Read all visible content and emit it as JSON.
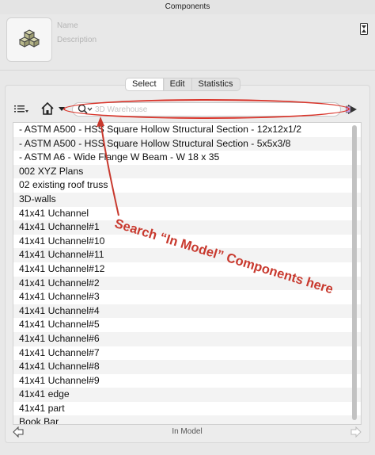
{
  "window": {
    "title": "Components"
  },
  "info": {
    "name_placeholder": "Name",
    "description_placeholder": "Description"
  },
  "tabs": [
    {
      "label": "Select",
      "active": true
    },
    {
      "label": "Edit",
      "active": false
    },
    {
      "label": "Statistics",
      "active": false
    }
  ],
  "search": {
    "placeholder": "3D Warehouse",
    "value": ""
  },
  "components": [
    "- ASTM A500 - HSS Square Hollow Structural Section - 12x12x1/2",
    "- ASTM A500 - HSS Square Hollow Structural Section - 5x5x3/8",
    "- ASTM A6 - Wide Flange W Beam - W 18 x 35",
    "002 XYZ Plans",
    "02 existing roof truss",
    "3D-walls",
    "41x41 Uchannel",
    "41x41 Uchannel#1",
    "41x41 Uchannel#10",
    "41x41 Uchannel#11",
    "41x41 Uchannel#12",
    "41x41 Uchannel#2",
    "41x41 Uchannel#3",
    "41x41 Uchannel#4",
    "41x41 Uchannel#5",
    "41x41 Uchannel#6",
    "41x41 Uchannel#7",
    "41x41 Uchannel#8",
    "41x41 Uchannel#9",
    "41x41 edge",
    "41x41 part",
    "Book Bar"
  ],
  "footer": {
    "location": "In Model"
  },
  "annotation": {
    "text": "Search “In Model” Components here",
    "color": "#c8392e"
  },
  "colors": {
    "accent_red": "#d9352b"
  },
  "icons": {
    "thumbnail": "cubes-icon",
    "list_view": "list-view-icon",
    "home": "home-icon",
    "search": "search-icon",
    "details": "details-arrow-icon",
    "back": "back-arrow-icon",
    "forward": "forward-arrow-icon",
    "side_toggle": "panel-toggle-icon"
  }
}
